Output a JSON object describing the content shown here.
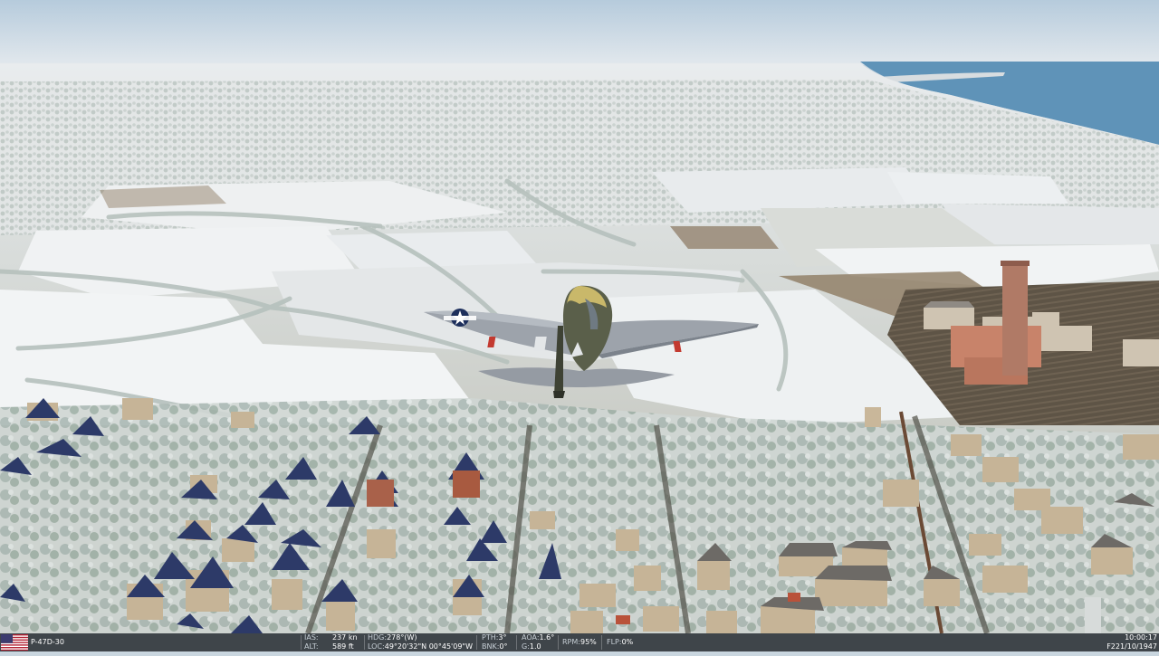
{
  "scene": {
    "description_tag": "flight-sim-external-view",
    "colors": {
      "sky_top": "#b9cede",
      "sky_horizon": "#dfe6ec",
      "sea": "#5f93b8",
      "snow": "#e6e9ec",
      "field_brown": "#8c7a64",
      "tree": "#b7c2bf",
      "roof_dark": "#2d3a66",
      "wall_beige": "#c9b79a",
      "factory_brick": "#c8836a"
    }
  },
  "aircraft": {
    "insignia_icon": "us-star-insignia-icon"
  },
  "hud": {
    "flag_icon": "us-flag-icon",
    "aircraft_name": "P-47D-30",
    "ias_label": "IAS:",
    "ias_value": "237 kn",
    "alt_label": "ALT:",
    "alt_value": "589 ft",
    "hdg_label": "HDG:",
    "hdg_value": "278°(W)",
    "loc_label": "LOC:",
    "loc_value": "49°20'32\"N 00°45'09\"W",
    "pth_label": "PTH:",
    "pth_value": "3°",
    "bnk_label": "BNK:",
    "bnk_value": "0°",
    "aoa_label": "AOA:",
    "aoa_value": "1.6°",
    "g_label": "G:",
    "g_value": "1.0",
    "rpm_label": "RPM:",
    "rpm_value": "95%",
    "flp_label": "FLP:",
    "flp_value": "0%",
    "time": "10:00:17",
    "date": "F221/10/1947"
  }
}
